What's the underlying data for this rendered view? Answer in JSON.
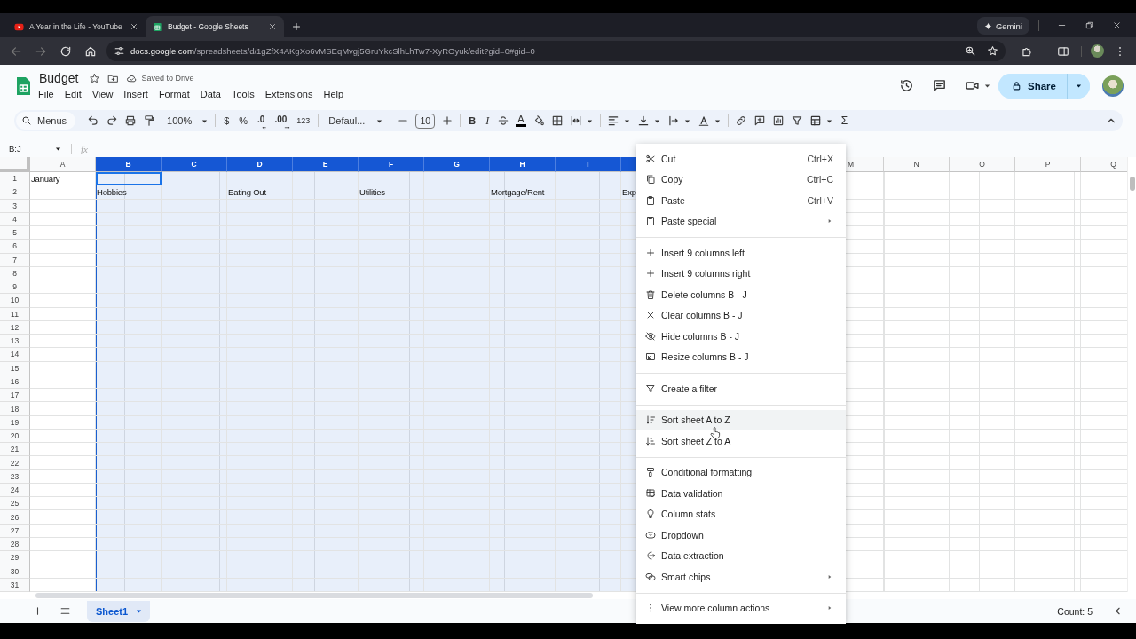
{
  "browser": {
    "tabs": [
      {
        "title": "A Year in the Life - YouTube",
        "selected": false
      },
      {
        "title": "Budget - Google Sheets",
        "selected": true
      }
    ],
    "gemini": "Gemini",
    "url_host": "docs.google.com",
    "url_path": "/spreadsheets/d/1gZfX4AKgXo6vMSEqMvgj5GruYkcSlhLhTw7-XyROyuk/edit?gid=0#gid=0"
  },
  "document": {
    "title": "Budget",
    "save_status": "Saved to Drive",
    "menus": [
      "File",
      "Edit",
      "View",
      "Insert",
      "Format",
      "Data",
      "Tools",
      "Extensions",
      "Help"
    ],
    "share": "Share"
  },
  "toolbar": {
    "search": "Menus",
    "zoom": "100%",
    "currency": "$",
    "percent": "%",
    "decrease_decimals": ".0",
    "increase_decimals": ".00",
    "number_format": "123",
    "font": "Defaul...",
    "font_size": "10",
    "bold": "B",
    "italic": "I",
    "text_color": "A",
    "functions": "Σ"
  },
  "formula_bar": {
    "name_box": "B:J",
    "fx": "fx"
  },
  "sheet": {
    "columns": [
      {
        "label": "A",
        "selected": false
      },
      {
        "label": "B",
        "selected": true
      },
      {
        "label": "C",
        "selected": true
      },
      {
        "label": "D",
        "selected": true
      },
      {
        "label": "E",
        "selected": true
      },
      {
        "label": "F",
        "selected": true
      },
      {
        "label": "G",
        "selected": true
      },
      {
        "label": "H",
        "selected": true
      },
      {
        "label": "I",
        "selected": true
      },
      {
        "selected": true
      },
      {},
      {},
      {
        "label": "M",
        "selected": false
      },
      {
        "label": "N",
        "selected": false
      },
      {
        "label": "O",
        "selected": false
      },
      {
        "label": "P",
        "selected": false
      },
      {
        "label": "Q",
        "selected": false
      }
    ],
    "rows": [
      {
        "number": "1",
        "cells": {
          "A": {
            "text": "January",
            "active": false
          },
          "B": {
            "active": true
          }
        }
      },
      {
        "number": "2",
        "cells": {
          "B": {
            "text": "Hobbies",
            "active": false
          },
          "D": {
            "text": "Eating Out",
            "active": false
          },
          "F": {
            "text": "Utilities",
            "active": false
          },
          "H": {
            "text": "Mortgage/Rent",
            "active": false
          },
          "J": {
            "text": "Exp",
            "active": false
          }
        }
      },
      {
        "number": "3"
      },
      {
        "number": "4"
      },
      {
        "number": "5"
      },
      {
        "number": "6"
      },
      {
        "number": "7"
      },
      {
        "number": "8"
      },
      {
        "number": "9"
      },
      {
        "number": "10"
      },
      {
        "number": "11"
      },
      {
        "number": "12"
      },
      {
        "number": "13"
      },
      {
        "number": "14"
      },
      {
        "number": "15"
      },
      {
        "number": "16"
      },
      {
        "number": "17"
      },
      {
        "number": "18"
      },
      {
        "number": "19"
      },
      {
        "number": "20"
      },
      {
        "number": "21"
      },
      {
        "number": "22"
      },
      {
        "number": "23"
      },
      {
        "number": "24"
      },
      {
        "number": "25"
      },
      {
        "number": "26"
      },
      {
        "number": "27"
      },
      {
        "number": "28"
      },
      {
        "number": "29"
      },
      {
        "number": "30"
      },
      {
        "number": "31"
      }
    ]
  },
  "context_menu": {
    "sections": [
      [
        {
          "label": "Cut",
          "shortcut": "Ctrl+X",
          "submenu": false,
          "highlighted": false
        },
        {
          "label": "Copy",
          "shortcut": "Ctrl+C",
          "submenu": false,
          "highlighted": false
        },
        {
          "label": "Paste",
          "shortcut": "Ctrl+V",
          "submenu": false,
          "highlighted": false
        },
        {
          "label": "Paste special",
          "submenu": true,
          "highlighted": false
        }
      ],
      [
        {
          "label": "Insert 9 columns left",
          "submenu": false,
          "highlighted": false
        },
        {
          "label": "Insert 9 columns right",
          "submenu": false,
          "highlighted": false
        },
        {
          "label": "Delete columns B - J",
          "submenu": false,
          "highlighted": false
        },
        {
          "label": "Clear columns B - J",
          "submenu": false,
          "highlighted": false
        },
        {
          "label": "Hide columns B - J",
          "submenu": false,
          "highlighted": false
        },
        {
          "label": "Resize columns B - J",
          "submenu": false,
          "highlighted": false
        }
      ],
      [
        {
          "label": "Create a filter",
          "submenu": false,
          "highlighted": false
        }
      ],
      [
        {
          "label": "Sort sheet A to Z",
          "submenu": false,
          "highlighted": true
        },
        {
          "label": "Sort sheet Z to A",
          "submenu": false,
          "highlighted": false
        }
      ],
      [
        {
          "label": "Conditional formatting",
          "submenu": false,
          "highlighted": false
        },
        {
          "label": "Data validation",
          "submenu": false,
          "highlighted": false
        },
        {
          "label": "Column stats",
          "submenu": false,
          "highlighted": false
        },
        {
          "label": "Dropdown",
          "submenu": false,
          "highlighted": false
        },
        {
          "label": "Data extraction",
          "submenu": false,
          "highlighted": false
        },
        {
          "label": "Smart chips",
          "submenu": true,
          "highlighted": false
        }
      ],
      [
        {
          "label": "View more column actions",
          "submenu": true,
          "highlighted": false
        }
      ]
    ]
  },
  "bottom_bar": {
    "sheets": [
      {
        "name": "Sheet1",
        "selected": true
      }
    ],
    "summary": "Count: 5"
  }
}
